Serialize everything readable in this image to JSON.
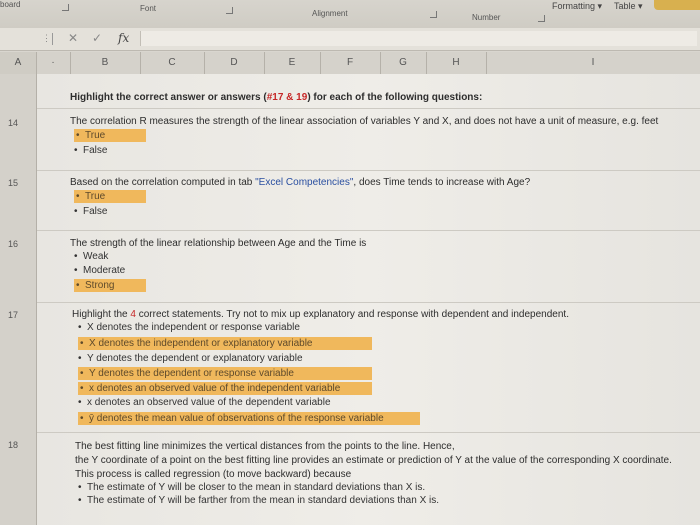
{
  "ribbon": {
    "clipboard": "board",
    "font": "Font",
    "alignment": "Alignment",
    "number": "Number",
    "formatting": "Formatting",
    "table": "Table"
  },
  "formula_bar": {
    "fx": "fx",
    "cancel_symbol": "✕",
    "enter_symbol": "✓",
    "value": ""
  },
  "columns": [
    "A",
    "B",
    "C",
    "D",
    "E",
    "F",
    "G",
    "H",
    "I"
  ],
  "header": {
    "prefix": "Highlight the correct answer or answers (",
    "ref": "#17 & 19",
    "suffix": ") for each of the following questions:"
  },
  "questions": [
    {
      "row": "14",
      "text": "The correlation R measures the strength of the linear association of variables Y and X, and does not have a unit of measure, e.g. feet",
      "options": [
        {
          "label": "True",
          "highlighted": true
        },
        {
          "label": "False",
          "highlighted": false
        }
      ]
    },
    {
      "row": "15",
      "text_a": "Based on the correlation computed in tab ",
      "text_link": "\"Excel Competencies\"",
      "text_b": ", does Time tends to increase with Age?",
      "options": [
        {
          "label": "True",
          "highlighted": true
        },
        {
          "label": "False",
          "highlighted": false
        }
      ]
    },
    {
      "row": "16",
      "text": "The strength of the linear relationship between Age and the Time is",
      "options": [
        {
          "label": "Weak",
          "highlighted": false
        },
        {
          "label": "Moderate",
          "highlighted": false
        },
        {
          "label": "Strong",
          "highlighted": true
        }
      ]
    },
    {
      "row": "17",
      "text_a": "Highlight the ",
      "text_num": "4",
      "text_b": " correct statements. Try not to mix up explanatory and response with dependent and independent.",
      "options": [
        {
          "label": "X denotes the independent or response variable",
          "highlighted": false
        },
        {
          "label": "X denotes the independent or explanatory variable",
          "highlighted": true
        },
        {
          "label": "Y denotes the dependent or explanatory variable",
          "highlighted": false
        },
        {
          "label": "Y denotes the dependent or response variable",
          "highlighted": true
        },
        {
          "label": "x denotes an observed value of the independent variable",
          "highlighted": true
        },
        {
          "label": "x denotes an observed value of the dependent variable",
          "highlighted": false
        },
        {
          "label": "ȳ denotes the mean value of observations of the response variable",
          "highlighted": true
        }
      ]
    },
    {
      "row": "18",
      "lines": [
        "The best fitting line minimizes the vertical distances from the points to the line. Hence,",
        "the Y coordinate of a point on the best fitting line provides an estimate or prediction of Y at the value of the corresponding X coordinate.",
        "This process is called regression (to move backward) because"
      ],
      "options": [
        {
          "label": "The estimate of Y will be closer to the mean in standard deviations than X is.",
          "highlighted": false
        },
        {
          "label": "The estimate of Y will be farther from the mean in standard deviations than X is.",
          "highlighted": false
        }
      ]
    }
  ],
  "colors": {
    "highlight": "#f0b85c",
    "accent_red": "#c62828",
    "link_blue": "#2a4fa0"
  }
}
